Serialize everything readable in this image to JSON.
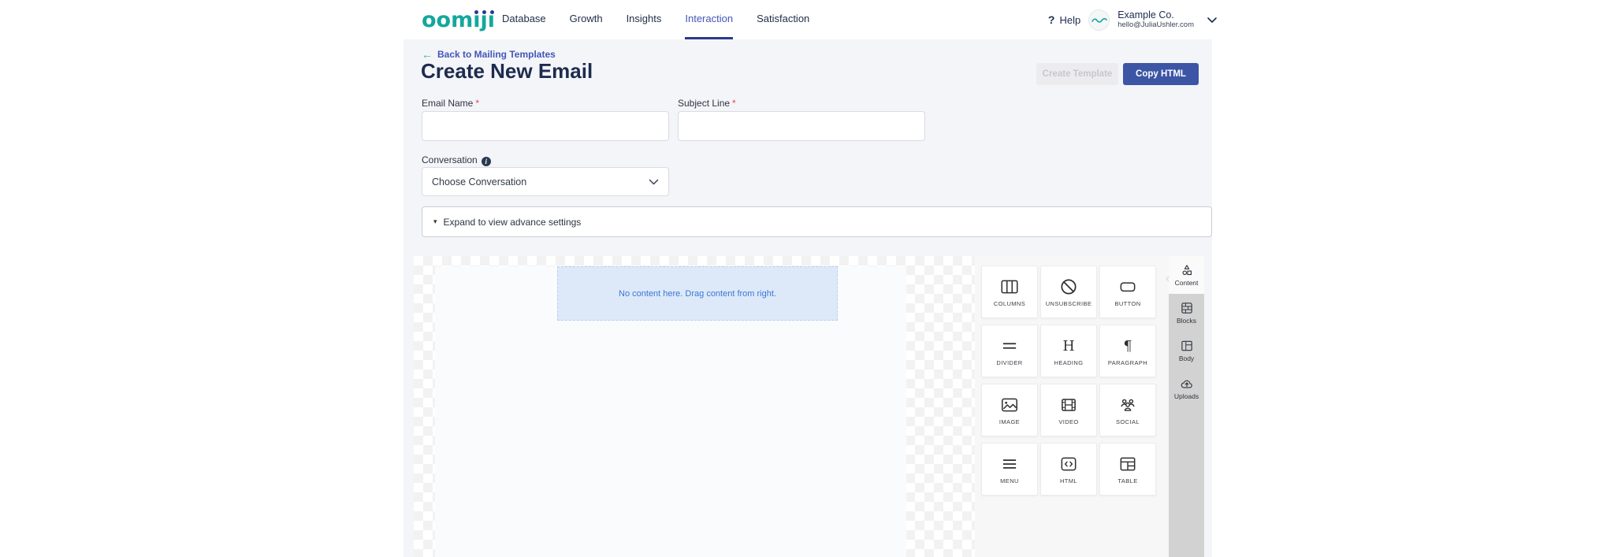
{
  "header": {
    "logo_text": "oomiji",
    "nav_items": [
      {
        "label": "Database",
        "active": false
      },
      {
        "label": "Growth",
        "active": false
      },
      {
        "label": "Insights",
        "active": false
      },
      {
        "label": "Interaction",
        "active": true
      },
      {
        "label": "Satisfaction",
        "active": false
      }
    ],
    "help_icon": "?",
    "help_label": "Help",
    "account": {
      "company": "Example Co.",
      "email": "hello@JuliaUshler.com"
    }
  },
  "page": {
    "back_link_label": "Back to Mailing Templates",
    "back_arrow": "←",
    "title": "Create New Email",
    "buttons": {
      "create_template": "Create Template",
      "copy_html": "Copy HTML"
    }
  },
  "form": {
    "email_name": {
      "label": "Email Name",
      "required": "*",
      "value": ""
    },
    "subject_line": {
      "label": "Subject Line",
      "required": "*",
      "value": ""
    },
    "conversation": {
      "label": "Conversation",
      "info_icon": "i",
      "selected": "Choose Conversation"
    },
    "advance_settings": {
      "caret": "▾",
      "label": "Expand to view advance settings"
    }
  },
  "canvas": {
    "empty_message": "No content here. Drag content from right."
  },
  "content_panel": {
    "tiles": [
      {
        "label": "COLUMNS",
        "icon": "columns-icon"
      },
      {
        "label": "UNSUBSCRIBE",
        "icon": "unsubscribe-icon"
      },
      {
        "label": "BUTTON",
        "icon": "button-icon"
      },
      {
        "label": "DIVIDER",
        "icon": "divider-icon"
      },
      {
        "label": "HEADING",
        "icon": "heading-icon"
      },
      {
        "label": "PARAGRAPH",
        "icon": "paragraph-icon"
      },
      {
        "label": "IMAGE",
        "icon": "image-icon"
      },
      {
        "label": "VIDEO",
        "icon": "video-icon"
      },
      {
        "label": "SOCIAL",
        "icon": "social-icon"
      },
      {
        "label": "MENU",
        "icon": "menu-icon"
      },
      {
        "label": "HTML",
        "icon": "html-icon"
      },
      {
        "label": "TABLE",
        "icon": "table-icon"
      }
    ]
  },
  "sidebar": {
    "items": [
      {
        "label": "Content",
        "icon": "content-shapes-icon",
        "active": true
      },
      {
        "label": "Blocks",
        "icon": "blocks-bricks-icon",
        "active": false
      },
      {
        "label": "Body",
        "icon": "body-layout-icon",
        "active": false
      },
      {
        "label": "Uploads",
        "icon": "uploads-cloud-icon",
        "active": false
      }
    ]
  },
  "colors": {
    "brand_teal": "#14A79D",
    "brand_navy": "#2B3990",
    "accent_blue": "#4356B9",
    "primary_button": "#3D55A5",
    "required_red": "#E5484D",
    "empty_box_bg": "#DDE9F8",
    "empty_box_text": "#3B76D8",
    "rail_bg": "#D2D2D3"
  }
}
